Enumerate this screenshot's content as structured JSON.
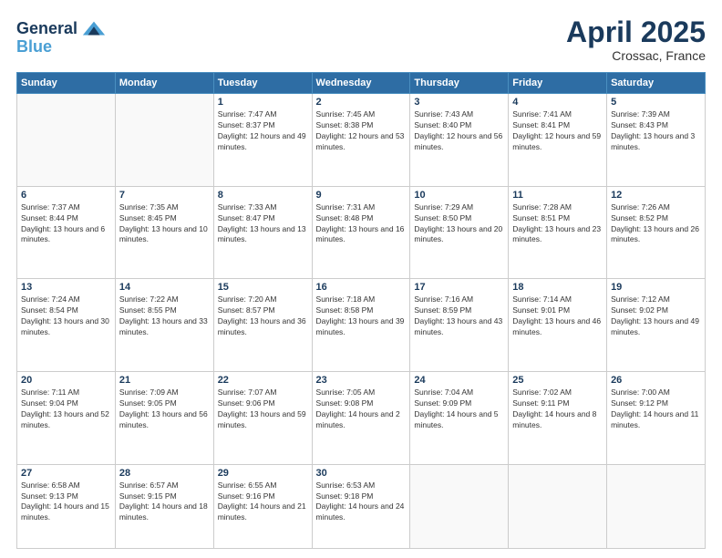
{
  "header": {
    "logo_line1": "General",
    "logo_line2": "Blue",
    "month": "April 2025",
    "location": "Crossac, France"
  },
  "days_of_week": [
    "Sunday",
    "Monday",
    "Tuesday",
    "Wednesday",
    "Thursday",
    "Friday",
    "Saturday"
  ],
  "weeks": [
    [
      {
        "day": "",
        "info": ""
      },
      {
        "day": "",
        "info": ""
      },
      {
        "day": "1",
        "info": "Sunrise: 7:47 AM\nSunset: 8:37 PM\nDaylight: 12 hours and 49 minutes."
      },
      {
        "day": "2",
        "info": "Sunrise: 7:45 AM\nSunset: 8:38 PM\nDaylight: 12 hours and 53 minutes."
      },
      {
        "day": "3",
        "info": "Sunrise: 7:43 AM\nSunset: 8:40 PM\nDaylight: 12 hours and 56 minutes."
      },
      {
        "day": "4",
        "info": "Sunrise: 7:41 AM\nSunset: 8:41 PM\nDaylight: 12 hours and 59 minutes."
      },
      {
        "day": "5",
        "info": "Sunrise: 7:39 AM\nSunset: 8:43 PM\nDaylight: 13 hours and 3 minutes."
      }
    ],
    [
      {
        "day": "6",
        "info": "Sunrise: 7:37 AM\nSunset: 8:44 PM\nDaylight: 13 hours and 6 minutes."
      },
      {
        "day": "7",
        "info": "Sunrise: 7:35 AM\nSunset: 8:45 PM\nDaylight: 13 hours and 10 minutes."
      },
      {
        "day": "8",
        "info": "Sunrise: 7:33 AM\nSunset: 8:47 PM\nDaylight: 13 hours and 13 minutes."
      },
      {
        "day": "9",
        "info": "Sunrise: 7:31 AM\nSunset: 8:48 PM\nDaylight: 13 hours and 16 minutes."
      },
      {
        "day": "10",
        "info": "Sunrise: 7:29 AM\nSunset: 8:50 PM\nDaylight: 13 hours and 20 minutes."
      },
      {
        "day": "11",
        "info": "Sunrise: 7:28 AM\nSunset: 8:51 PM\nDaylight: 13 hours and 23 minutes."
      },
      {
        "day": "12",
        "info": "Sunrise: 7:26 AM\nSunset: 8:52 PM\nDaylight: 13 hours and 26 minutes."
      }
    ],
    [
      {
        "day": "13",
        "info": "Sunrise: 7:24 AM\nSunset: 8:54 PM\nDaylight: 13 hours and 30 minutes."
      },
      {
        "day": "14",
        "info": "Sunrise: 7:22 AM\nSunset: 8:55 PM\nDaylight: 13 hours and 33 minutes."
      },
      {
        "day": "15",
        "info": "Sunrise: 7:20 AM\nSunset: 8:57 PM\nDaylight: 13 hours and 36 minutes."
      },
      {
        "day": "16",
        "info": "Sunrise: 7:18 AM\nSunset: 8:58 PM\nDaylight: 13 hours and 39 minutes."
      },
      {
        "day": "17",
        "info": "Sunrise: 7:16 AM\nSunset: 8:59 PM\nDaylight: 13 hours and 43 minutes."
      },
      {
        "day": "18",
        "info": "Sunrise: 7:14 AM\nSunset: 9:01 PM\nDaylight: 13 hours and 46 minutes."
      },
      {
        "day": "19",
        "info": "Sunrise: 7:12 AM\nSunset: 9:02 PM\nDaylight: 13 hours and 49 minutes."
      }
    ],
    [
      {
        "day": "20",
        "info": "Sunrise: 7:11 AM\nSunset: 9:04 PM\nDaylight: 13 hours and 52 minutes."
      },
      {
        "day": "21",
        "info": "Sunrise: 7:09 AM\nSunset: 9:05 PM\nDaylight: 13 hours and 56 minutes."
      },
      {
        "day": "22",
        "info": "Sunrise: 7:07 AM\nSunset: 9:06 PM\nDaylight: 13 hours and 59 minutes."
      },
      {
        "day": "23",
        "info": "Sunrise: 7:05 AM\nSunset: 9:08 PM\nDaylight: 14 hours and 2 minutes."
      },
      {
        "day": "24",
        "info": "Sunrise: 7:04 AM\nSunset: 9:09 PM\nDaylight: 14 hours and 5 minutes."
      },
      {
        "day": "25",
        "info": "Sunrise: 7:02 AM\nSunset: 9:11 PM\nDaylight: 14 hours and 8 minutes."
      },
      {
        "day": "26",
        "info": "Sunrise: 7:00 AM\nSunset: 9:12 PM\nDaylight: 14 hours and 11 minutes."
      }
    ],
    [
      {
        "day": "27",
        "info": "Sunrise: 6:58 AM\nSunset: 9:13 PM\nDaylight: 14 hours and 15 minutes."
      },
      {
        "day": "28",
        "info": "Sunrise: 6:57 AM\nSunset: 9:15 PM\nDaylight: 14 hours and 18 minutes."
      },
      {
        "day": "29",
        "info": "Sunrise: 6:55 AM\nSunset: 9:16 PM\nDaylight: 14 hours and 21 minutes."
      },
      {
        "day": "30",
        "info": "Sunrise: 6:53 AM\nSunset: 9:18 PM\nDaylight: 14 hours and 24 minutes."
      },
      {
        "day": "",
        "info": ""
      },
      {
        "day": "",
        "info": ""
      },
      {
        "day": "",
        "info": ""
      }
    ]
  ]
}
